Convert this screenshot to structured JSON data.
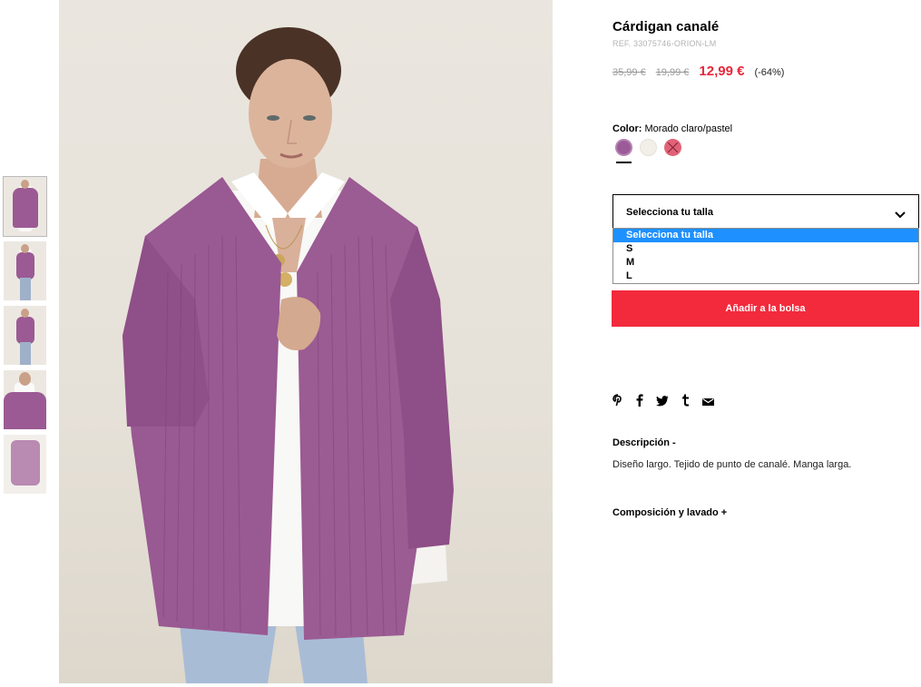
{
  "product": {
    "title": "Cárdigan canalé",
    "ref": "REF. 33075746-ORION-LM",
    "prices": {
      "old_1": "35,99 €",
      "old_2": "19,99 €",
      "current": "12,99 €",
      "discount": "(-64%)"
    },
    "color": {
      "label": "Color:",
      "value": "Morado claro/pastel",
      "swatches": [
        "#9c5b98",
        "#f2efe9",
        "#e06278"
      ]
    },
    "size": {
      "select_label": "Selecciona tu talla",
      "options": [
        "Selecciona tu talla",
        "S",
        "M",
        "L"
      ]
    },
    "add_to_bag": "Añadir a la bolsa",
    "share_icons": [
      "pinterest-icon",
      "facebook-icon",
      "twitter-icon",
      "tumblr-icon",
      "email-icon"
    ],
    "description": {
      "heading": "Descripción  -",
      "text": "Diseño largo. Tejido de punto de canalé. Manga larga."
    },
    "composition": {
      "heading": "Composición y lavado  +"
    }
  },
  "colors": {
    "accent": "#f22a3c",
    "sale_price": "#e5283a",
    "dropdown_highlight": "#1e90ff",
    "cardigan": "#9b5a93"
  }
}
